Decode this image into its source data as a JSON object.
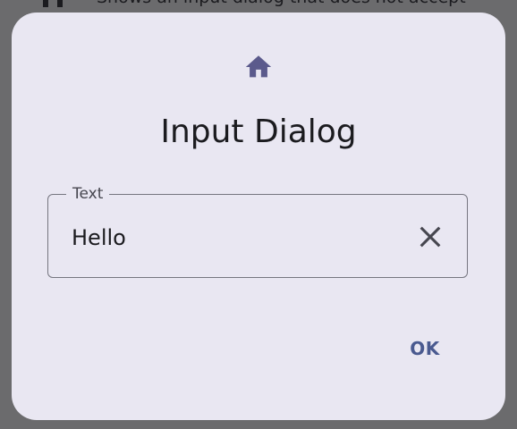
{
  "background": {
    "item_text": "Shows an input dialog that does not accept"
  },
  "dialog": {
    "icon": "home-icon",
    "title": "Input Dialog",
    "field": {
      "label": "Text",
      "value": "Hello",
      "clear_icon": "close-icon"
    },
    "ok_label": "OK"
  },
  "colors": {
    "scrim": "#6b6b6d",
    "dialog_surface": "#e9e7f2",
    "icon": "#5b5a8c",
    "text": "#1b1b1f",
    "outline": "#767680",
    "primary": "#4a5a90"
  }
}
